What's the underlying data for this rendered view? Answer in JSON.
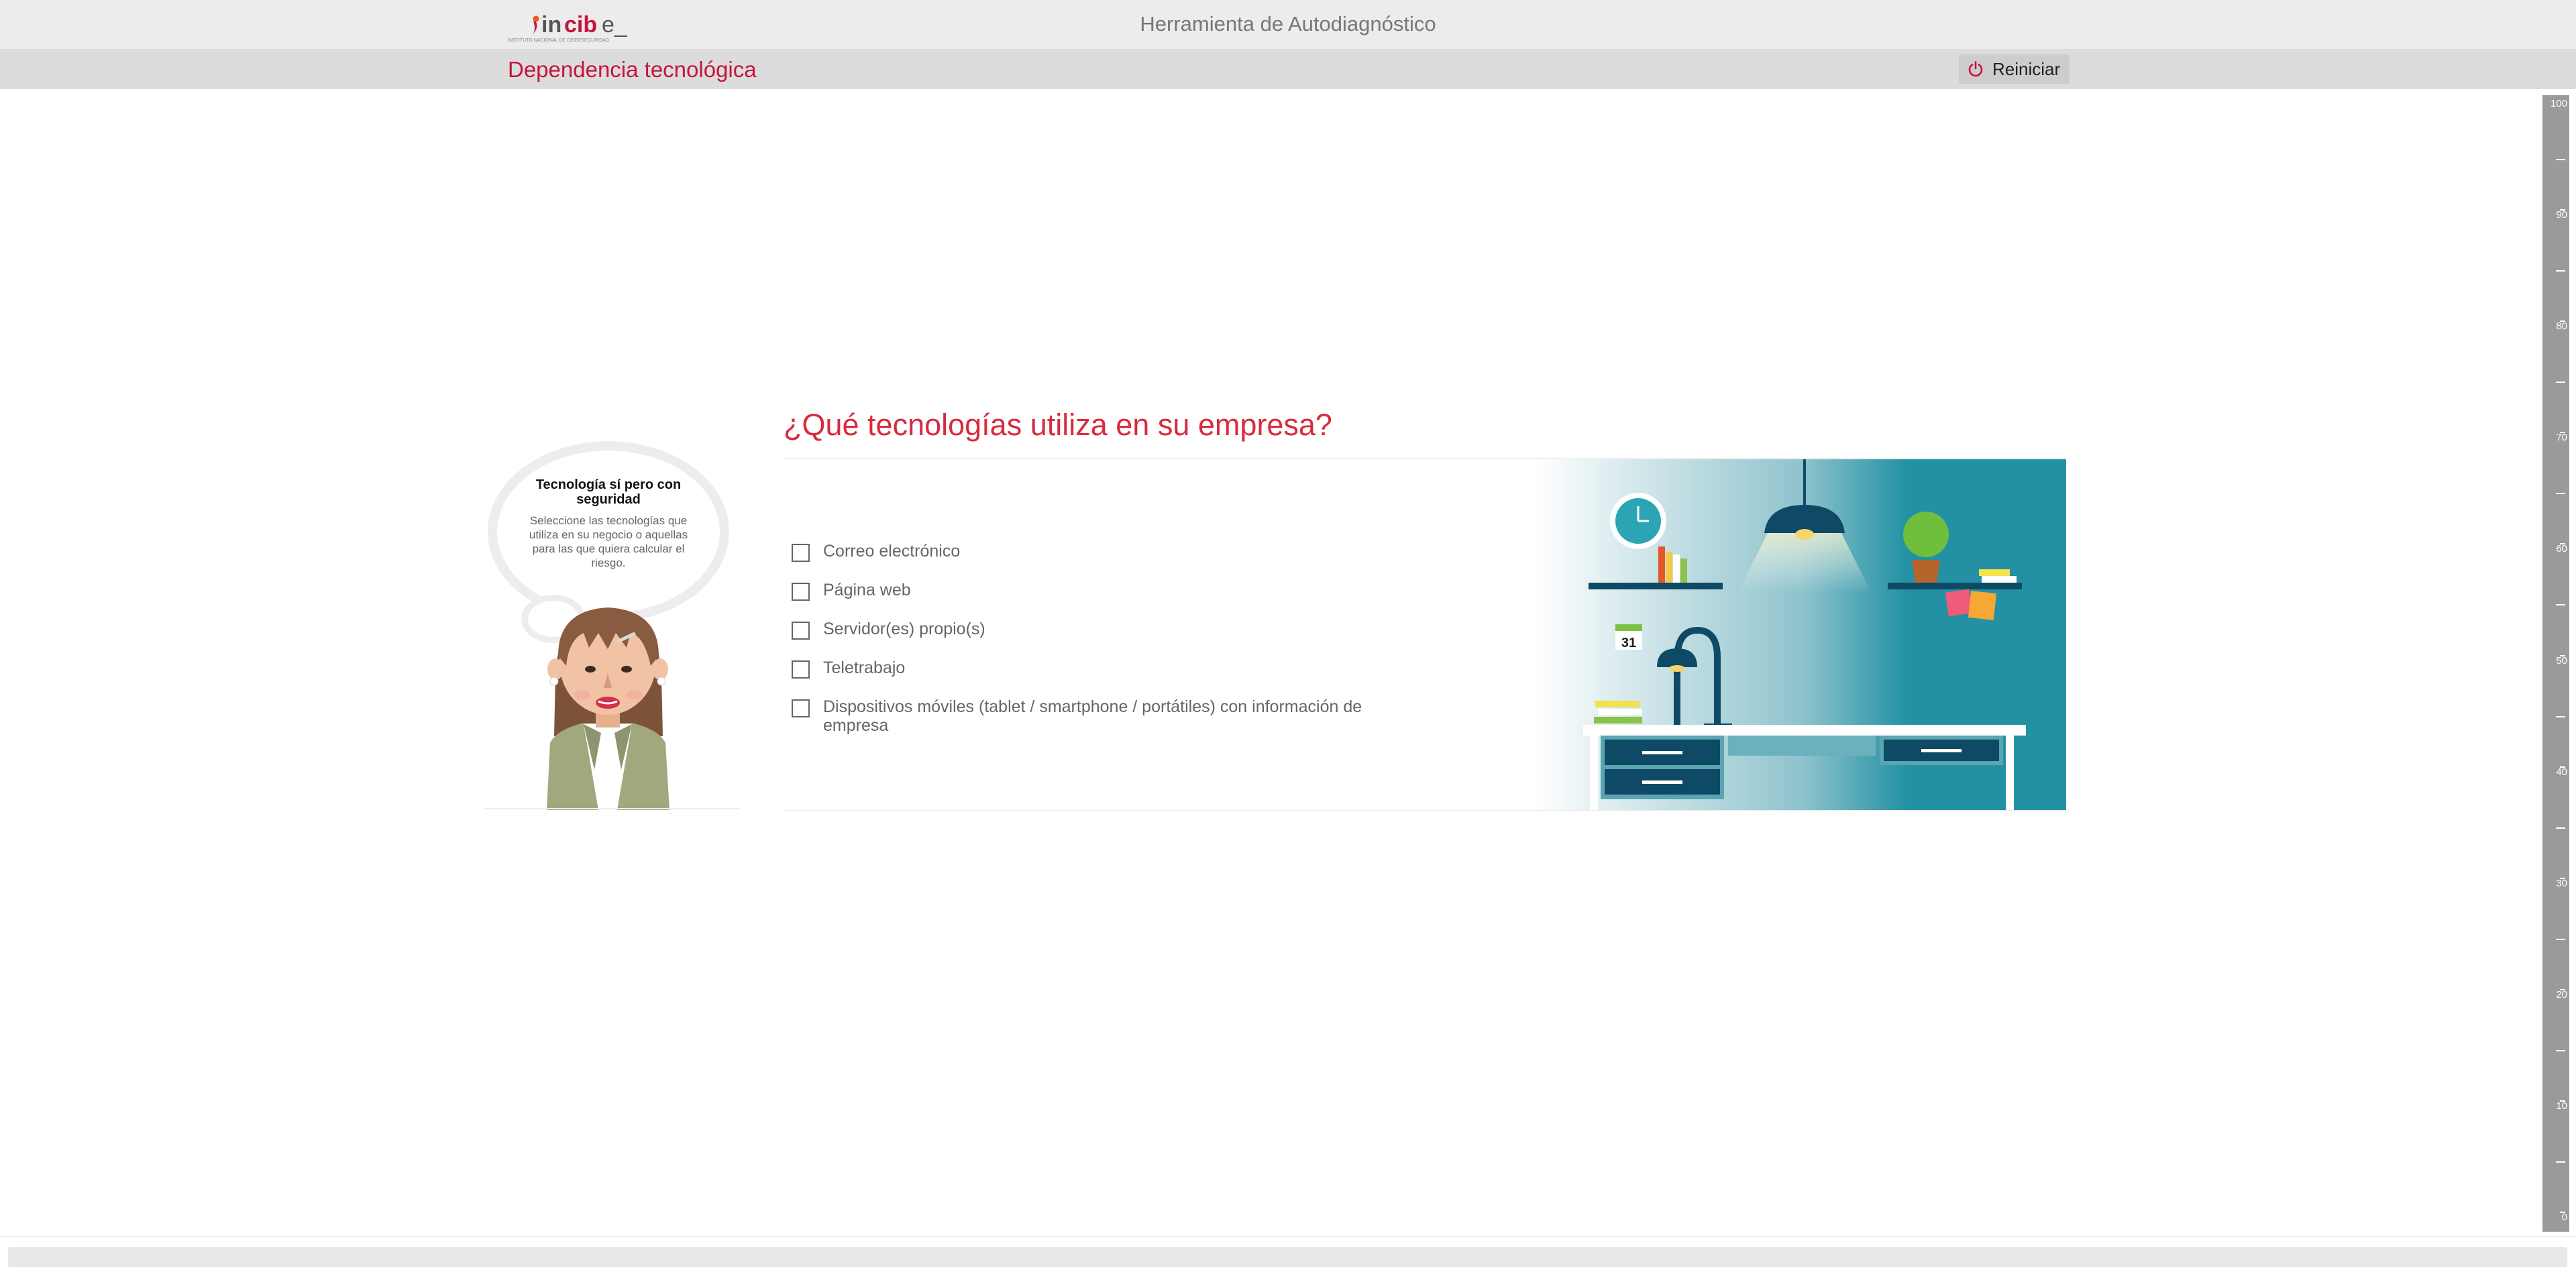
{
  "header": {
    "logo_text": "incibe_",
    "logo_subtext": "INSTITUTO NACIONAL DE CIBERSEGURIDAD",
    "app_title": "Herramienta de Autodiagnóstico"
  },
  "subheader": {
    "section_title": "Dependencia tecnológica",
    "restart_label": "Reiniciar"
  },
  "assistant": {
    "bubble_title": "Tecnología sí pero con seguridad",
    "bubble_body": "Seleccione las tecnologías que utiliza en su negocio o aquellas para las que quiera calcular el riesgo."
  },
  "question": {
    "text": "¿Qué tecnologías utiliza en su empresa?",
    "options": [
      {
        "label": "Correo electrónico",
        "checked": false
      },
      {
        "label": "Página web",
        "checked": false
      },
      {
        "label": "Servidor(es) propio(s)",
        "checked": false
      },
      {
        "label": "Teletrabajo",
        "checked": false
      },
      {
        "label": "Dispositivos móviles (tablet / smartphone / portátiles) con información de empresa",
        "checked": false
      }
    ]
  },
  "illustration": {
    "calendar_day": "31"
  },
  "risk_gauge": {
    "labels": [
      "100",
      "90",
      "80",
      "70",
      "60",
      "50",
      "40",
      "30",
      "20",
      "10",
      "0"
    ],
    "level": 0
  },
  "colors": {
    "accent": "#d72b3f",
    "section_title": "#c5153a",
    "teal": "#2391a3",
    "navy": "#0e4a66"
  }
}
